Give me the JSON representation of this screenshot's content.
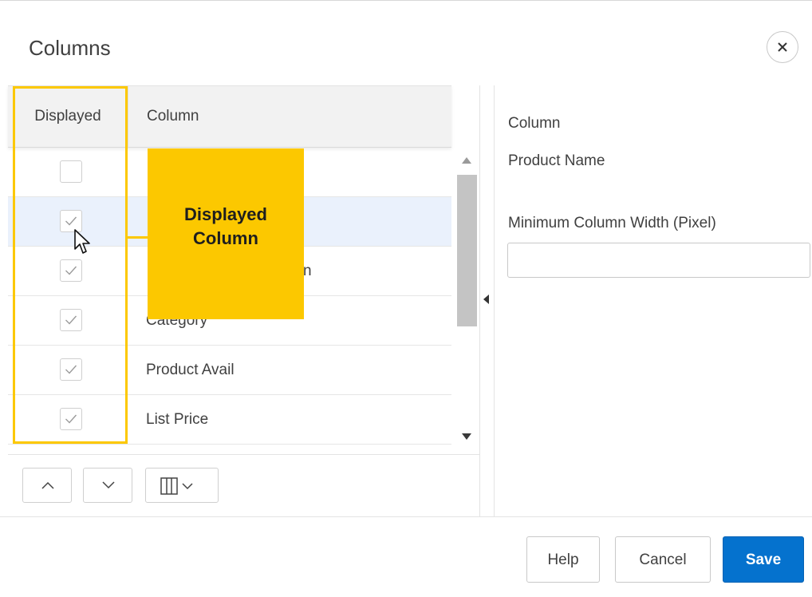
{
  "dialog": {
    "title": "Columns",
    "close_icon": "close-icon"
  },
  "grid": {
    "headers": {
      "displayed": "Displayed",
      "column": "Column"
    },
    "rows": [
      {
        "displayed": false,
        "label": ""
      },
      {
        "displayed": true,
        "label": "",
        "selected": true
      },
      {
        "displayed": true,
        "label": "n"
      },
      {
        "displayed": true,
        "label": "Category"
      },
      {
        "displayed": true,
        "label": "Product Avail"
      },
      {
        "displayed": true,
        "label": "List Price"
      }
    ],
    "toolbar_icons": [
      "chevron-up-icon",
      "chevron-down-icon",
      "columns-dropdown-icon"
    ]
  },
  "properties": {
    "column_label": "Column",
    "column_value": "Product Name",
    "min_width_label": "Minimum Column Width (Pixel)",
    "min_width_value": ""
  },
  "footer": {
    "help": "Help",
    "cancel": "Cancel",
    "save": "Save"
  },
  "annotation": {
    "callout_line1": "Displayed",
    "callout_line2": "Column"
  },
  "colors": {
    "accent_yellow": "#fcc800",
    "save_blue": "#0572ce",
    "selected_row": "#eaf1fc"
  }
}
